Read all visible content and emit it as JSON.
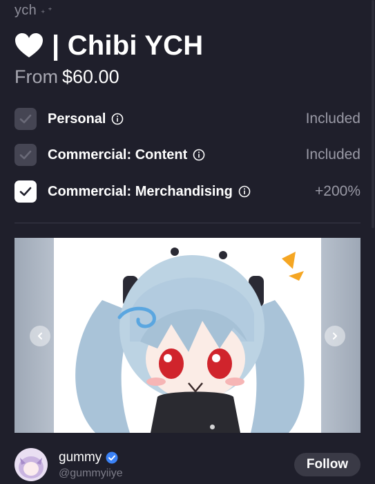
{
  "breadcrumb": {
    "text": "ych",
    "sparkle": "₊ ⁺"
  },
  "header": {
    "title": "| Chibi YCH",
    "price_prefix": "From",
    "price_value": "$60.00"
  },
  "licenses": [
    {
      "label": "Personal",
      "value": "Included",
      "checked": false
    },
    {
      "label": "Commercial: Content",
      "value": "Included",
      "checked": false
    },
    {
      "label": "Commercial: Merchandising",
      "value": "+200%",
      "checked": true
    }
  ],
  "carousel": {
    "current_slide": 1
  },
  "artist": {
    "name": "gummy",
    "handle": "@gummyiiye",
    "follow_label": "Follow",
    "verified": true
  },
  "colors": {
    "background": "#1f1f2b",
    "checkbox_off": "#454553",
    "checkbox_on": "#ffffff",
    "verified": "#3b82f6",
    "follow_bg": "#3a3a46"
  }
}
